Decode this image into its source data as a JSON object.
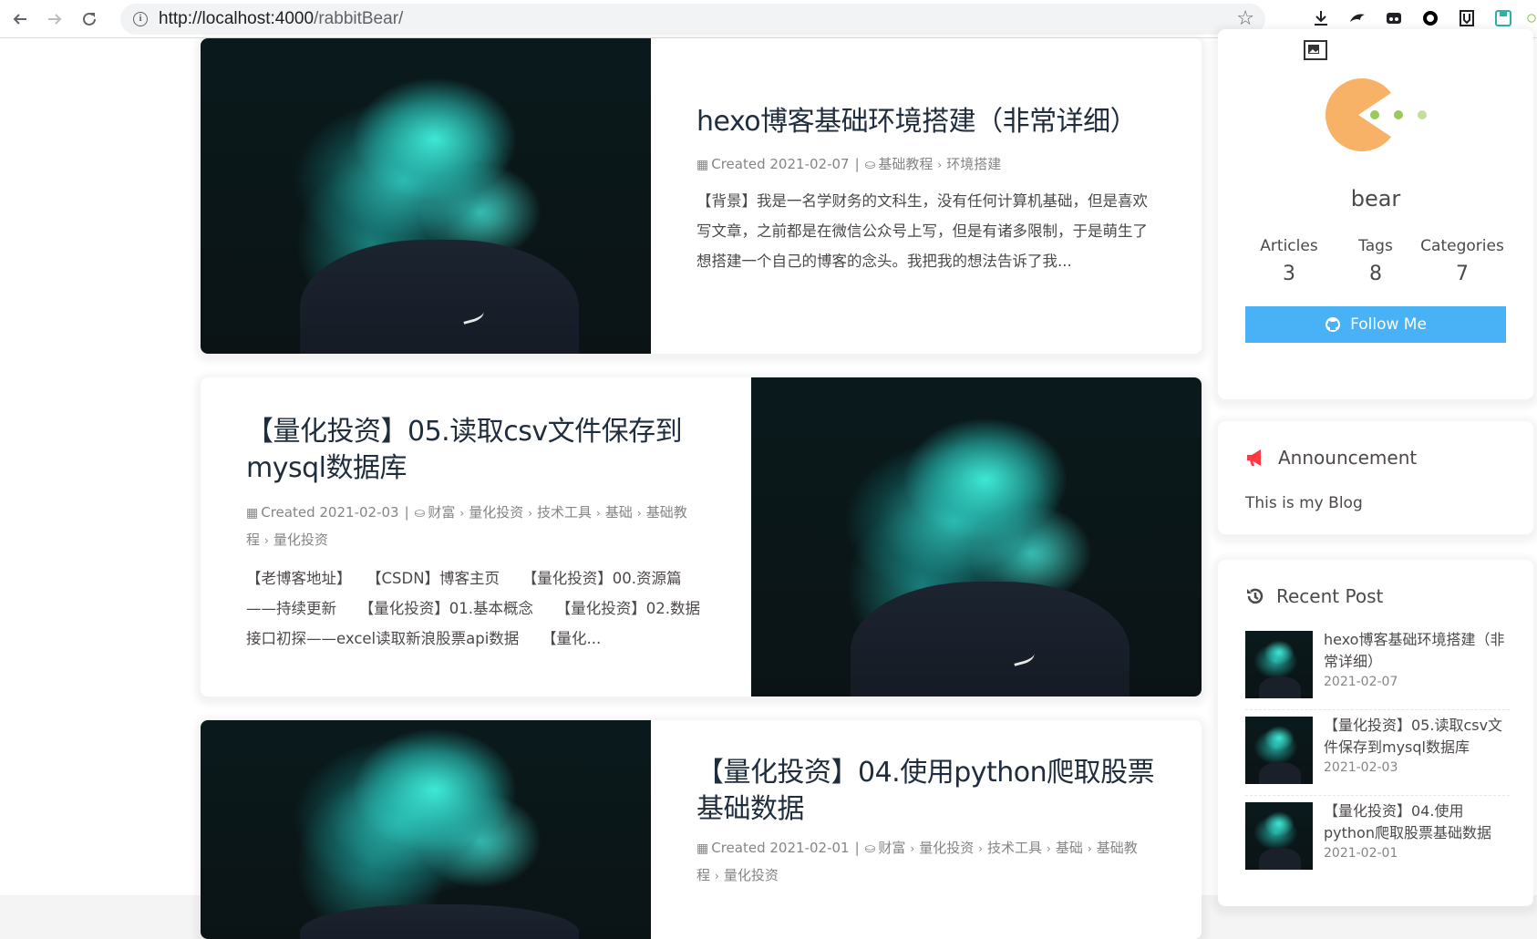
{
  "browser": {
    "url_host": "http://localhost:4000",
    "url_path": "/rabbitBear/"
  },
  "posts": [
    {
      "title": "hexo博客基础环境搭建（非常详细）",
      "created_label": "Created",
      "date": "2021-02-07",
      "categories": [
        "基础教程",
        "环境搭建"
      ],
      "excerpt": "【背景】我是一名学财务的文科生，没有任何计算机基础，但是喜欢写文章，之前都是在微信公众号上写，但是有诸多限制，于是萌生了想搭建一个自己的博客的念头。我把我的想法告诉了我..."
    },
    {
      "title": "【量化投资】05.读取csv文件保存到mysql数据库",
      "created_label": "Created",
      "date": "2021-02-03",
      "categories": [
        "财富",
        "量化投资",
        "技术工具",
        "基础",
        "基础教程",
        "量化投资"
      ],
      "excerpt": "【老博客地址】　　【CSDN】博客主页　　【量化投资】00.资源篇——持续更新　　【量化投资】01.基本概念　　【量化投资】02.数据接口初探——excel读取新浪股票api数据　　【量化..."
    },
    {
      "title": "【量化投资】04.使用python爬取股票基础数据",
      "created_label": "Created",
      "date": "2021-02-01",
      "categories": [
        "财富",
        "量化投资",
        "技术工具",
        "基础",
        "基础教程",
        "量化投资"
      ]
    }
  ],
  "author": {
    "name": "bear",
    "articles_label": "Articles",
    "articles": "3",
    "tags_label": "Tags",
    "tags": "8",
    "categories_label": "Categories",
    "categories": "7",
    "follow_label": "Follow Me"
  },
  "announcement": {
    "title": "Announcement",
    "text": "This is my Blog"
  },
  "recent": {
    "title": "Recent Post",
    "items": [
      {
        "title": "hexo博客基础环境搭建（非常详细）",
        "date": "2021-02-07"
      },
      {
        "title": "【量化投资】05.读取csv文件保存到mysql数据库",
        "date": "2021-02-03"
      },
      {
        "title": "【量化投资】04.使用python爬取股票基础数据",
        "date": "2021-02-01"
      }
    ]
  },
  "colors": {
    "accent": "#49b1f5",
    "avatar": "#f7b267",
    "avatar_dots": "#9cc95b",
    "announcement_icon": "#ff3842"
  },
  "icons": {
    "calendar": "calendar-icon",
    "inbox": "inbox-icon",
    "github": "github-icon",
    "bullhorn": "bullhorn-icon",
    "history": "history-icon"
  }
}
